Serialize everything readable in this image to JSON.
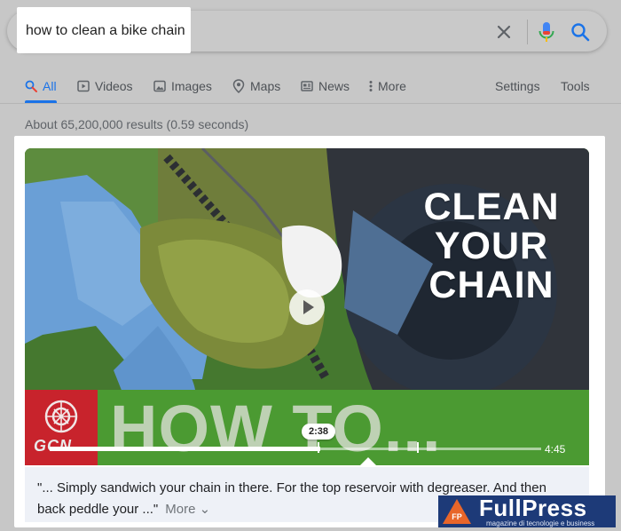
{
  "search": {
    "query": "how to clean a bike chain"
  },
  "tabs": [
    {
      "label": "All",
      "icon": "search-icon"
    },
    {
      "label": "Videos",
      "icon": "play-icon"
    },
    {
      "label": "Images",
      "icon": "image-icon"
    },
    {
      "label": "Maps",
      "icon": "map-pin-icon"
    },
    {
      "label": "News",
      "icon": "newspaper-icon"
    },
    {
      "label": "More",
      "icon": "kebab-icon"
    }
  ],
  "tools": {
    "settings": "Settings",
    "tools": "Tools"
  },
  "result_stats": "About 65,200,000 results (0.59 seconds)",
  "video": {
    "overlay_lines": [
      "CLEAN",
      "YOUR",
      "CHAIN"
    ],
    "banner_text": "HOW TO...",
    "logo_text": "GCN",
    "timestamp": "2:38",
    "duration": "4:45",
    "progress_fraction": 0.55
  },
  "transcript": {
    "text": "\"... Simply sandwich your chain in there. For the top reservoir with degreaser. And then back peddle your ...\"",
    "more_label": "More"
  },
  "watermark": {
    "logo_letters": "FP",
    "name": "FullPress",
    "tagline": "magazine di tecnologie e business"
  },
  "colors": {
    "accent": "#1a73e8",
    "banner_green": "#4b9a32",
    "logo_red": "#c8232c",
    "watermark_blue": "#1d3a78"
  }
}
